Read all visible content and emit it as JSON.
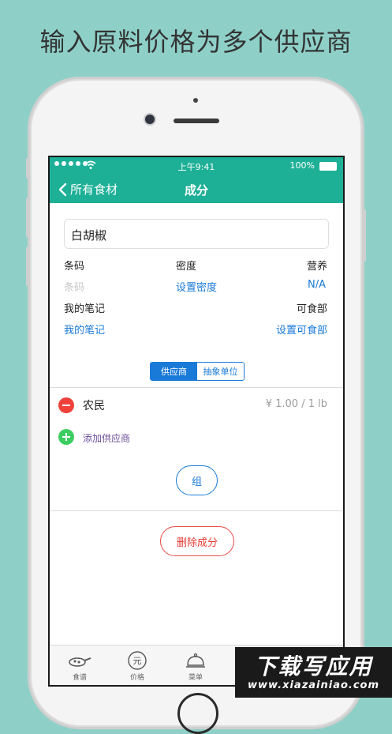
{
  "headline": "输入原料价格为多个供应商",
  "status": {
    "time": "上午9:41",
    "battery": "100%"
  },
  "nav": {
    "back_label": "所有食材",
    "title": "成分"
  },
  "ingredient": {
    "name": "白胡椒",
    "barcode_label": "条码",
    "barcode_placeholder": "条码",
    "density_label": "密度",
    "density_link": "设置密度",
    "nutrition_label": "营养",
    "nutrition_value": "N/A",
    "notes_label": "我的笔记",
    "notes_link": "我的笔记",
    "edible_label": "可食部",
    "edible_link": "设置可食部"
  },
  "segment": {
    "suppliers": "供应商",
    "abstract_units": "抽象单位",
    "selected": "供应商"
  },
  "suppliers": [
    {
      "name": "农民",
      "price": "¥ 1.00 / 1 lb"
    }
  ],
  "add_supplier_label": "添加供应商",
  "group_button": "组",
  "delete_button": "删除成分",
  "tabs": [
    {
      "label": "食谱",
      "icon": "pan-icon"
    },
    {
      "label": "价格",
      "icon": "yuan-icon"
    },
    {
      "label": "菜单",
      "icon": "cloche-icon"
    }
  ],
  "watermark": {
    "line1": "下载写应用",
    "line2": "www.xiazainiao.com"
  },
  "colors": {
    "accent": "#1eb097",
    "link": "#1a7ad8",
    "danger": "#e83a35",
    "add": "#3ccd62",
    "background": "#8ed0c8"
  }
}
